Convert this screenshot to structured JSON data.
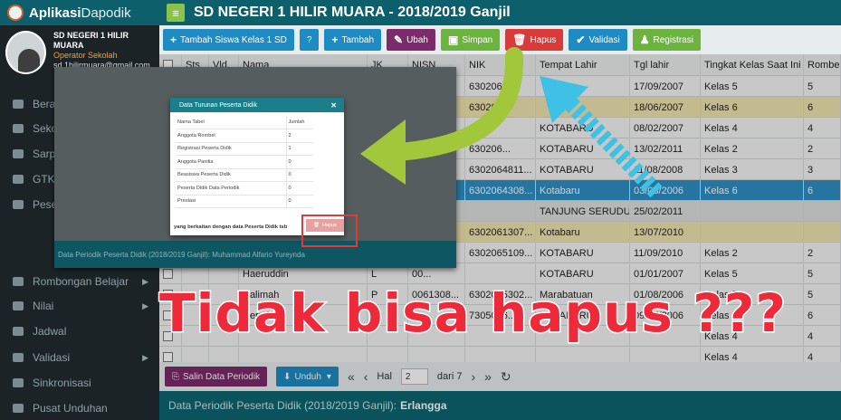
{
  "brand": {
    "part1": "Aplikasi",
    "part2": "Dapodik"
  },
  "profile": {
    "school": "SD NEGERI 1 HILIR MUARA",
    "role": "Operator Sekolah",
    "email": "sd.1hilirmuara@gmail.com"
  },
  "sidebar": {
    "items": [
      {
        "label": "Beranda",
        "icon": "monitor-icon"
      },
      {
        "label": "Sekolah",
        "icon": "building-icon"
      },
      {
        "label": "Sarpras",
        "icon": "road-icon"
      },
      {
        "label": "GTK",
        "icon": "cap-icon"
      },
      {
        "label": "Peserta Didik",
        "icon": "smile-icon"
      },
      {
        "label": "Rombongan Belajar",
        "icon": "users-icon"
      },
      {
        "label": "Nilai",
        "icon": "list-icon"
      },
      {
        "label": "Jadwal",
        "icon": "users-icon"
      },
      {
        "label": "Validasi",
        "icon": "check-icon"
      },
      {
        "label": "Sinkronisasi",
        "icon": "sync-icon"
      },
      {
        "label": "Pusat Unduhan",
        "icon": "download-icon"
      }
    ]
  },
  "header": {
    "title": "SD NEGERI 1 HILIR MUARA - 2018/2019 Ganjil"
  },
  "toolbar": {
    "buttons": [
      {
        "label": "Tambah Siswa Kelas 1 SD",
        "color": "#1e8bc3"
      },
      {
        "label": "?",
        "color": "#1e8bc3"
      },
      {
        "label": "Tambah",
        "color": "#1e8bc3"
      },
      {
        "label": "Ubah",
        "color": "#7b2a6a"
      },
      {
        "label": "Simpan",
        "color": "#6db33f"
      },
      {
        "label": "Hapus",
        "color": "#d93a3a"
      },
      {
        "label": "Validasi",
        "color": "#1e8bc3"
      },
      {
        "label": "Registrasi",
        "color": "#6db33f"
      }
    ]
  },
  "table": {
    "columns": [
      "Sts",
      "Vld",
      "Nama",
      "JK",
      "NISN",
      "NIK",
      "Tempat Lahir",
      "Tgl lahir",
      "Tingkat Kelas Saat Ini",
      "Rombel"
    ],
    "rows": [
      {
        "nama": "",
        "jk": "",
        "nisn": "",
        "nik": "630206...",
        "tempat": "",
        "tgl": "17/09/2007",
        "kelas": "Kelas 5",
        "rombel": "5",
        "style": ""
      },
      {
        "nama": "",
        "jk": "",
        "nisn": "",
        "nik": "630206...",
        "tempat": "",
        "tgl": "18/06/2007",
        "kelas": "Kelas 6",
        "rombel": "6",
        "style": "alt-yellow"
      },
      {
        "nama": "",
        "jk": "",
        "nisn": "",
        "nik": "",
        "tempat": "KOTABARU",
        "tgl": "08/02/2007",
        "kelas": "Kelas 4",
        "rombel": "4",
        "style": ""
      },
      {
        "nama": "",
        "jk": "",
        "nisn": "",
        "nik": "630206...",
        "tempat": "KOTABARU",
        "tgl": "13/02/2011",
        "kelas": "Kelas 2",
        "rombel": "2",
        "style": ""
      },
      {
        "nama": "",
        "jk": "",
        "nisn": "",
        "nik": "6302064811...",
        "tempat": "KOTABARU",
        "tgl": "11/08/2008",
        "kelas": "Kelas 3",
        "rombel": "3",
        "style": ""
      },
      {
        "nama": "",
        "jk": "",
        "nisn": "",
        "nik": "6302064308...",
        "tempat": "Kotabaru",
        "tgl": "03/08/2006",
        "kelas": "Kelas 6",
        "rombel": "6",
        "style": "alt-blue"
      },
      {
        "nama": "",
        "jk": "",
        "nisn": "",
        "nik": "",
        "tempat": "TANJUNG SERUDUNG",
        "tgl": "25/02/2011",
        "kelas": "",
        "rombel": "",
        "style": "alt-gray"
      },
      {
        "nama": "",
        "jk": "",
        "nisn": "",
        "nik": "6302061307...",
        "tempat": "Kotabaru",
        "tgl": "13/07/2010",
        "kelas": "",
        "rombel": "",
        "style": "alt-yellow"
      },
      {
        "nama": "",
        "jk": "",
        "nisn": "",
        "nik": "6302065109...",
        "tempat": "KOTABARU",
        "tgl": "11/09/2010",
        "kelas": "Kelas 2",
        "rombel": "2",
        "style": ""
      },
      {
        "nama": "Haeruddin",
        "jk": "L",
        "nisn": "00...",
        "nik": "",
        "tempat": "KOTABARU",
        "tgl": "01/01/2007",
        "kelas": "Kelas 5",
        "rombel": "5",
        "style": ""
      },
      {
        "nama": "Halimah",
        "jk": "P",
        "nisn": "0061308...",
        "nik": "6302015302...",
        "tempat": "Marabatuan",
        "tgl": "01/08/2006",
        "kelas": "Kelas 5",
        "rombel": "5",
        "style": ""
      },
      {
        "nama": "Hermina",
        "jk": "P",
        "nisn": "",
        "nik": "7305086...",
        "tempat": "KOTABARU",
        "tgl": "09/07/2006",
        "kelas": "Kelas 6",
        "rombel": "6",
        "style": ""
      },
      {
        "nama": "",
        "jk": "",
        "nisn": "",
        "nik": "",
        "tempat": "",
        "tgl": "",
        "kelas": "Kelas 4",
        "rombel": "4",
        "style": ""
      },
      {
        "nama": "",
        "jk": "",
        "nisn": "",
        "nik": "",
        "tempat": "",
        "tgl": "",
        "kelas": "Kelas 4",
        "rombel": "4",
        "style": ""
      }
    ]
  },
  "pager": {
    "salin_label": "Salin Data Periodik",
    "unduh_label": "Unduh",
    "hal_label": "Hal",
    "page": "2",
    "of_label": "dari 7"
  },
  "footer": {
    "label": "Data Periodik Peserta Didik (2018/2019 Ganjil):",
    "student": "Erlangga"
  },
  "inner": {
    "bottom_label": "Data Periodik Peserta Didik (2018/2019 Ganjil): Muhammad Alfario Yureynda",
    "modal": {
      "title": "Data Turunan Peserta Didik",
      "col_name": "Nama Tabel",
      "col_count": "Jumlah",
      "rows": [
        {
          "name": "Anggota Rombel",
          "count": "2"
        },
        {
          "name": "Registrasi Peserta Didik",
          "count": "1"
        },
        {
          "name": "Anggota Panitia",
          "count": "0"
        },
        {
          "name": "Beasiswa Peserta Didik",
          "count": "0"
        },
        {
          "name": "Peserta Didik Data Periodik",
          "count": "0"
        },
        {
          "name": "Prestasi",
          "count": "0"
        }
      ],
      "footer_text": "yang berkaitan dengan data Peserta Didik tsb",
      "hapus_label": "Hapus"
    }
  },
  "caption": "Tidak bisa hapus ???",
  "colors": {
    "arrow_green": "#a2c73a",
    "arrow_blue": "#3fc1e6",
    "caption_red": "#ee2a3a"
  }
}
